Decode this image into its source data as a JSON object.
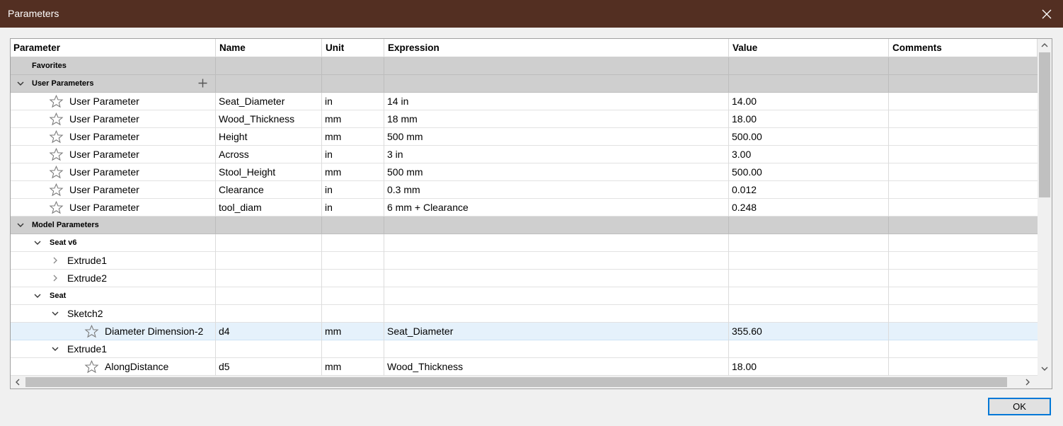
{
  "window": {
    "title": "Parameters"
  },
  "columns": [
    "Parameter",
    "Name",
    "Unit",
    "Expression",
    "Value",
    "Comments"
  ],
  "groups": {
    "favorites": "Favorites",
    "user_parameters": "User Parameters",
    "model_parameters": "Model Parameters"
  },
  "user_params": [
    {
      "type": "User Parameter",
      "name": "Seat_Diameter",
      "unit": "in",
      "expression": "14 in",
      "value": "14.00",
      "comment": ""
    },
    {
      "type": "User Parameter",
      "name": "Wood_Thickness",
      "unit": "mm",
      "expression": "18 mm",
      "value": "18.00",
      "comment": ""
    },
    {
      "type": "User Parameter",
      "name": "Height",
      "unit": "mm",
      "expression": "500 mm",
      "value": "500.00",
      "comment": ""
    },
    {
      "type": "User Parameter",
      "name": "Across",
      "unit": "in",
      "expression": "3 in",
      "value": "3.00",
      "comment": ""
    },
    {
      "type": "User Parameter",
      "name": "Stool_Height",
      "unit": "mm",
      "expression": "500 mm",
      "value": "500.00",
      "comment": ""
    },
    {
      "type": "User Parameter",
      "name": "Clearance",
      "unit": "in",
      "expression": "0.3 mm",
      "value": "0.012",
      "comment": ""
    },
    {
      "type": "User Parameter",
      "name": "tool_diam",
      "unit": "in",
      "expression": "6 mm + Clearance",
      "value": "0.248",
      "comment": ""
    }
  ],
  "model_tree": {
    "seat_v6": {
      "label": "Seat v6",
      "children": [
        "Extrude1",
        "Extrude2"
      ]
    },
    "seat": {
      "label": "Seat",
      "sketch2": {
        "label": "Sketch2",
        "param": {
          "type": "Diameter Dimension-2",
          "name": "d4",
          "unit": "mm",
          "expression": "Seat_Diameter",
          "value": "355.60"
        }
      },
      "extrude1": {
        "label": "Extrude1",
        "param": {
          "type": "AlongDistance",
          "name": "d5",
          "unit": "mm",
          "expression": "Wood_Thickness",
          "value": "18.00"
        }
      }
    }
  },
  "buttons": {
    "ok": "OK"
  }
}
